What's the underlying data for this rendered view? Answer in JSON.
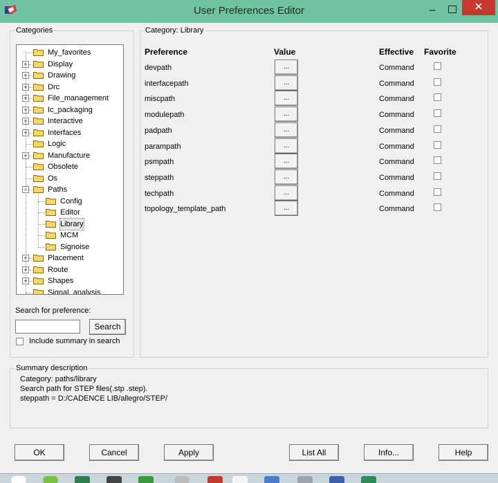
{
  "window": {
    "title": "User Preferences Editor",
    "minimize": "–",
    "close": "✕"
  },
  "categories": {
    "label": "Categories",
    "items": [
      {
        "label": "My_favorites",
        "expander": "",
        "level": 0
      },
      {
        "label": "Display",
        "expander": "+",
        "level": 0
      },
      {
        "label": "Drawing",
        "expander": "+",
        "level": 0
      },
      {
        "label": "Drc",
        "expander": "+",
        "level": 0
      },
      {
        "label": "File_management",
        "expander": "+",
        "level": 0
      },
      {
        "label": "Ic_packaging",
        "expander": "+",
        "level": 0
      },
      {
        "label": "Interactive",
        "expander": "+",
        "level": 0
      },
      {
        "label": "Interfaces",
        "expander": "+",
        "level": 0
      },
      {
        "label": "Logic",
        "expander": "",
        "level": 0
      },
      {
        "label": "Manufacture",
        "expander": "+",
        "level": 0
      },
      {
        "label": "Obsolete",
        "expander": "",
        "level": 0
      },
      {
        "label": "Os",
        "expander": "",
        "level": 0
      },
      {
        "label": "Paths",
        "expander": "−",
        "level": 0
      },
      {
        "label": "Config",
        "expander": "",
        "level": 1
      },
      {
        "label": "Editor",
        "expander": "",
        "level": 1
      },
      {
        "label": "Library",
        "expander": "",
        "level": 1,
        "selected": true
      },
      {
        "label": "MCM",
        "expander": "",
        "level": 1
      },
      {
        "label": "Signoise",
        "expander": "",
        "level": 1
      },
      {
        "label": "Placement",
        "expander": "+",
        "level": 0
      },
      {
        "label": "Route",
        "expander": "+",
        "level": 0
      },
      {
        "label": "Shapes",
        "expander": "+",
        "level": 0
      },
      {
        "label": "Signal_analysis",
        "expander": "",
        "level": 0
      }
    ],
    "scroll_up": "▲",
    "scroll_down": "▼"
  },
  "search": {
    "label": "Search for preference:",
    "value": "",
    "button": "Search",
    "include_summary_label": "Include summary in search"
  },
  "category_panel": {
    "label": "Category:  Library",
    "headers": {
      "preference": "Preference",
      "value": "Value",
      "effective": "Effective",
      "favorite": "Favorite"
    },
    "rows": [
      {
        "name": "devpath",
        "value": "...",
        "effective": "Command"
      },
      {
        "name": "interfacepath",
        "value": "...",
        "effective": "Command"
      },
      {
        "name": "miscpath",
        "value": "...",
        "effective": "Command"
      },
      {
        "name": "modulepath",
        "value": "...",
        "effective": "Command"
      },
      {
        "name": "padpath",
        "value": "...",
        "effective": "Command"
      },
      {
        "name": "parampath",
        "value": "...",
        "effective": "Command"
      },
      {
        "name": "psmpath",
        "value": "...",
        "effective": "Command"
      },
      {
        "name": "steppath",
        "value": "...",
        "effective": "Command"
      },
      {
        "name": "techpath",
        "value": "...",
        "effective": "Command"
      },
      {
        "name": "topology_template_path",
        "value": "...",
        "effective": "Command"
      }
    ]
  },
  "summary": {
    "label": "Summary description",
    "lines": [
      "Category: paths/library",
      "Search path for STEP files(.stp .step).",
      "steppath = D:/CADENCE LIB/allegro/STEP/"
    ]
  },
  "buttons": {
    "ok": "OK",
    "cancel": "Cancel",
    "apply": "Apply",
    "list_all": "List All",
    "info": "Info...",
    "help": "Help"
  },
  "colors": {
    "titlebar": "#6fc3a2",
    "close": "#c7382f",
    "folder": "#f5d76e",
    "folder_edge": "#8a6d00"
  }
}
